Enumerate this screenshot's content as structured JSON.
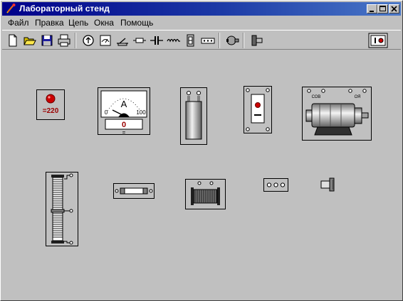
{
  "window": {
    "title": "Лабораторный стенд",
    "controls": [
      "minimize",
      "maximize",
      "close"
    ]
  },
  "menu": {
    "items": [
      {
        "label": "Файл"
      },
      {
        "label": "Правка"
      },
      {
        "label": "Цепь"
      },
      {
        "label": "Окна"
      },
      {
        "label": "Помощь"
      }
    ]
  },
  "toolbar": {
    "buttons": [
      {
        "icon": "new-file-icon"
      },
      {
        "icon": "open-folder-icon"
      },
      {
        "icon": "save-disk-icon"
      },
      {
        "icon": "print-icon"
      },
      {
        "icon": "source-icon"
      },
      {
        "icon": "meter-icon"
      },
      {
        "icon": "switch-icon"
      },
      {
        "icon": "fuse-icon"
      },
      {
        "icon": "capacitor-icon"
      },
      {
        "icon": "inductor-icon"
      },
      {
        "icon": "rheostat-icon"
      },
      {
        "icon": "resistor-icon"
      },
      {
        "icon": "motor-icon"
      },
      {
        "icon": "terminal-icon"
      },
      {
        "icon": "panel-view-icon"
      }
    ]
  },
  "components": {
    "power_source": {
      "label": "=220",
      "led_color": "#cc0000"
    },
    "ammeter": {
      "unit": "A",
      "scale_min": "0",
      "scale_max": "100",
      "reading": "0",
      "polarity": "="
    },
    "motor": {
      "label_left": "СОВ",
      "label_right": "ОЯ"
    }
  }
}
